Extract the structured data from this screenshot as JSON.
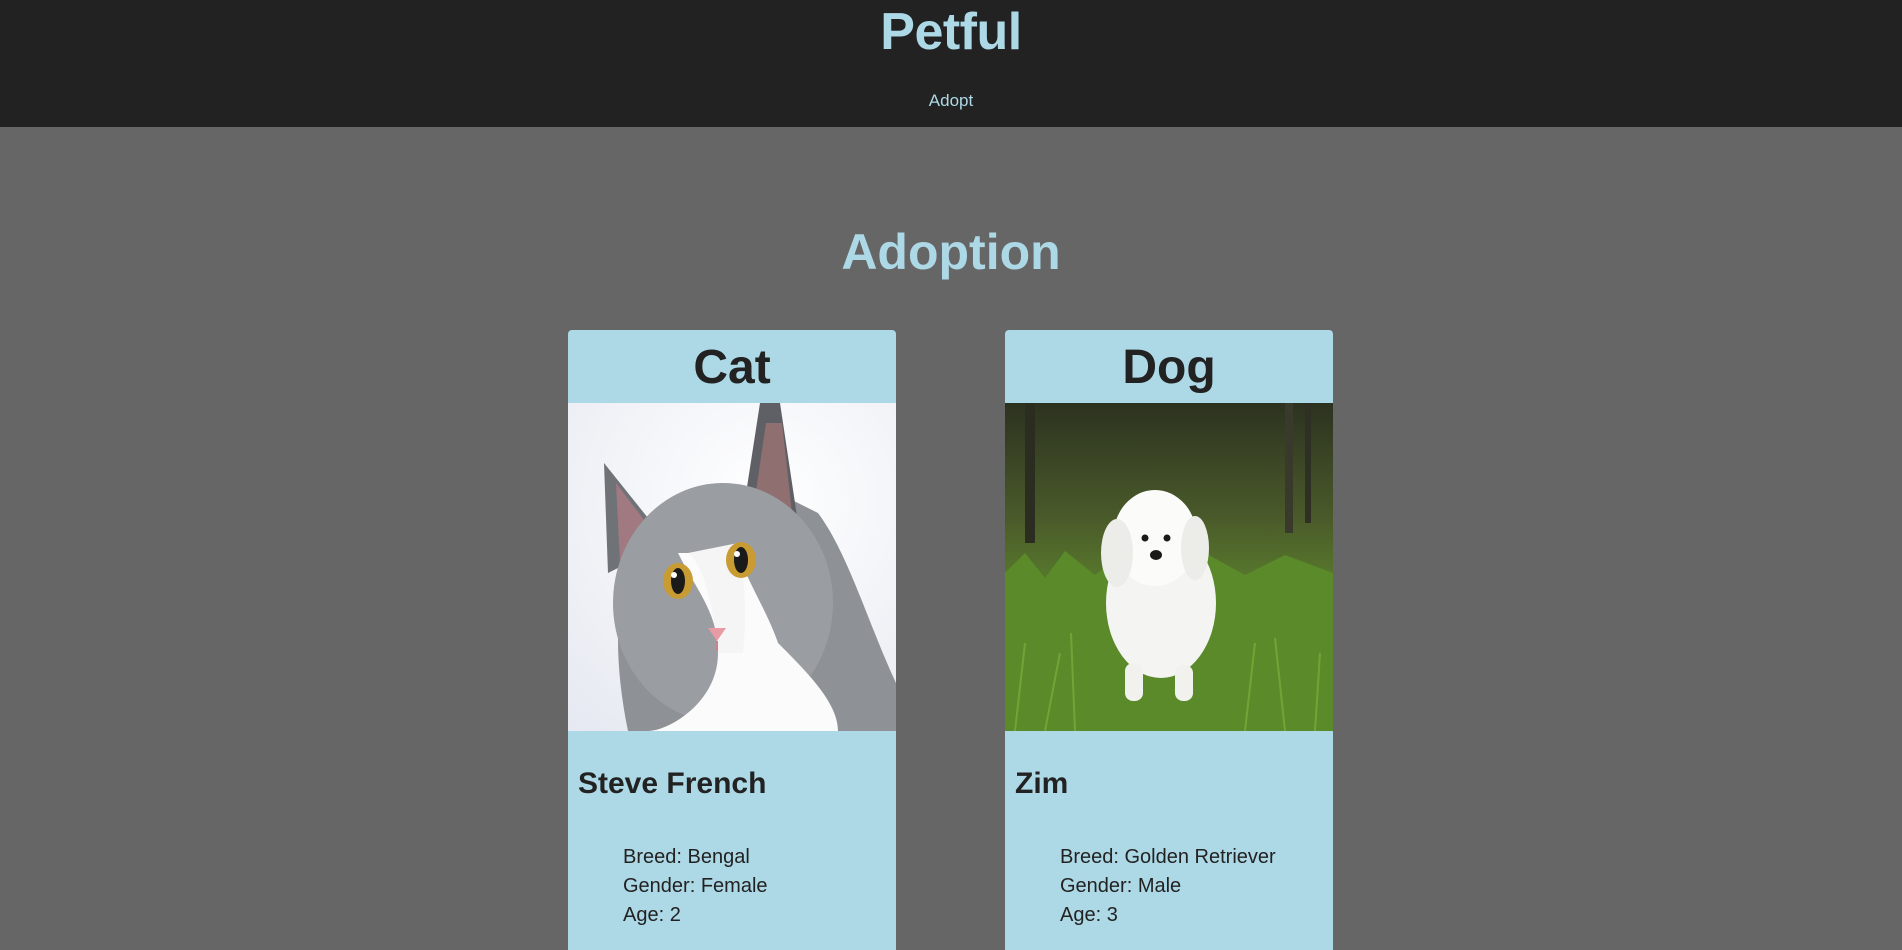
{
  "header": {
    "brand": "Petful",
    "nav": {
      "adopt_label": "Adopt"
    }
  },
  "main": {
    "heading": "Adoption",
    "cards": [
      {
        "category": "Cat",
        "photo_icon": "cat-photo",
        "name": "Steve French",
        "breed": "Breed: Bengal",
        "gender": "Gender: Female",
        "age": "Age: 2"
      },
      {
        "category": "Dog",
        "photo_icon": "dog-photo",
        "name": "Zim",
        "breed": "Breed: Golden Retriever",
        "gender": "Gender: Male",
        "age": "Age: 3"
      }
    ]
  },
  "colors": {
    "header_bg": "#222222",
    "page_bg": "#666666",
    "accent": "#add8e6",
    "text_dark": "#222222"
  }
}
